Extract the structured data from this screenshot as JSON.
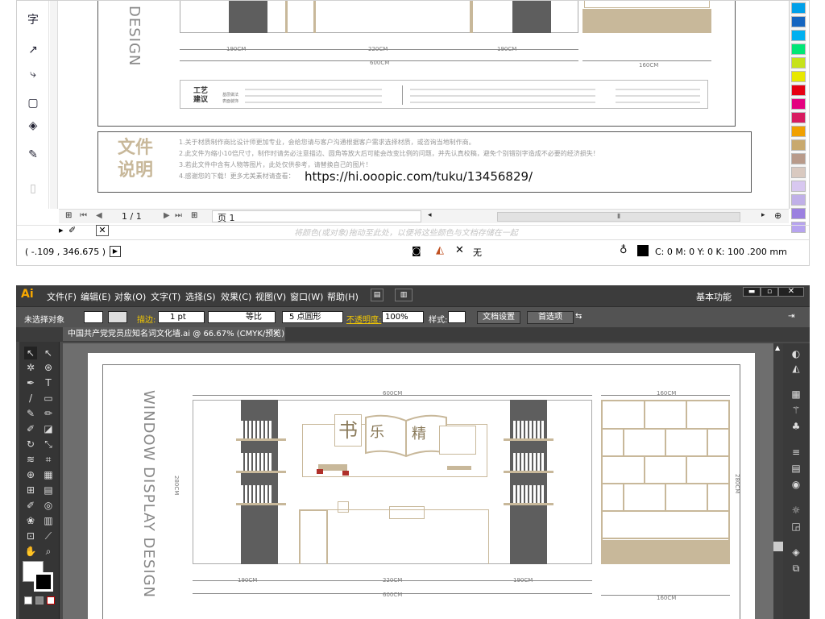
{
  "corel": {
    "design_text": "DESIGN",
    "dims_top": {
      "left": "190CM",
      "mid": "220CM",
      "right": "190CM",
      "total": "600CM",
      "right_width": "160CM"
    },
    "process_label_1": "工艺",
    "process_label_2": "建议",
    "process_sub": "基层做法",
    "process_sub2": "表面装饰",
    "note_title_1": "文件",
    "note_title_2": "说明",
    "notes": [
      "1.关于材质制作商比设计师更加专业，会给您请与客户沟通根据客户需求选择材质，或咨询当地制作商。",
      "2.此文件为缩小10倍尺寸，制作时请务必注意描边、圆角等放大后可能会改变比例的问题，并先认真校稿，避免个别错别字造成不必要的经济损失！",
      "3.若此文件中含有人物等图片，此处仅供参考，请替换自己的图片！",
      "4.感谢您的下载！更多尤美素材请查看："
    ],
    "url": "https://hi.ooopic.com/tuku/13456829/",
    "page_counter": "1 / 1",
    "page_tab": "页 1",
    "status_hint": "将颜色(或对象)拖动至此处，以便将这些颜色与文档存储在一起",
    "coords": "( -.109 , 346.675 )",
    "fill_none": "无",
    "color_readout": "C: 0 M: 0 Y: 0 K: 100  .200 mm",
    "palette": [
      "#00a0e9",
      "#1565c0",
      "#00b0f0",
      "#00e676",
      "#c6e21a",
      "#e8e800",
      "#e60012",
      "#e4007f",
      "#d81b60",
      "#f0a000",
      "#c8a96e",
      "#b89a8a",
      "#d9c9c0",
      "#d8c8f0",
      "#c0b0e8",
      "#9b80e0",
      "#b7a4ef"
    ]
  },
  "ai": {
    "logo": "Ai",
    "menu": [
      "文件(F)",
      "编辑(E)",
      "对象(O)",
      "文字(T)",
      "选择(S)",
      "效果(C)",
      "视图(V)",
      "窗口(W)",
      "帮助(H)"
    ],
    "workspace": "基本功能",
    "ctrl": {
      "no_selection": "未选择对象",
      "stroke_label": "描边:",
      "stroke_value": "1 pt",
      "stroke_style": "等比",
      "brush": "5 点圆形",
      "opacity_label": "不透明度:",
      "opacity_value": "100%",
      "style_label": "样式:",
      "doc_setup": "文档设置",
      "prefs": "首选项"
    },
    "tab_title": "中国共产党党员应知名词文化墙.ai @ 66.67% (CMYK/预览)",
    "tab_close": "×",
    "window_display": "WINDOW DISPLAY DESIGN",
    "dims": {
      "total_top": "600CM",
      "right_top": "160CM",
      "height_left": "280CM",
      "height_right": "280CM",
      "b_left": "190CM",
      "b_mid": "220CM",
      "b_right": "190CM",
      "b_total": "600CM",
      "b_right_width": "160CM"
    },
    "center_chars": [
      "书",
      "乐",
      "精"
    ]
  }
}
